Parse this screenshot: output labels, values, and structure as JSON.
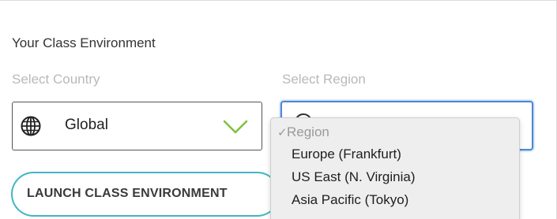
{
  "section": {
    "title": "Your Class Environment"
  },
  "country": {
    "label": "Select Country",
    "value": "Global",
    "icon": "globe-icon"
  },
  "region": {
    "label": "Select Region",
    "focus_color": "#4f88d2",
    "dropdown": {
      "selected_marker": "✓",
      "options": [
        {
          "label": "Region",
          "selected": true,
          "placeholder": true
        },
        {
          "label": "Europe (Frankfurt)"
        },
        {
          "label": "US East (N. Virginia)"
        },
        {
          "label": "Asia Pacific (Tokyo)"
        }
      ]
    }
  },
  "actions": {
    "launch_label": "LAUNCH CLASS ENVIRONMENT",
    "accent": "#3fb6c4"
  }
}
